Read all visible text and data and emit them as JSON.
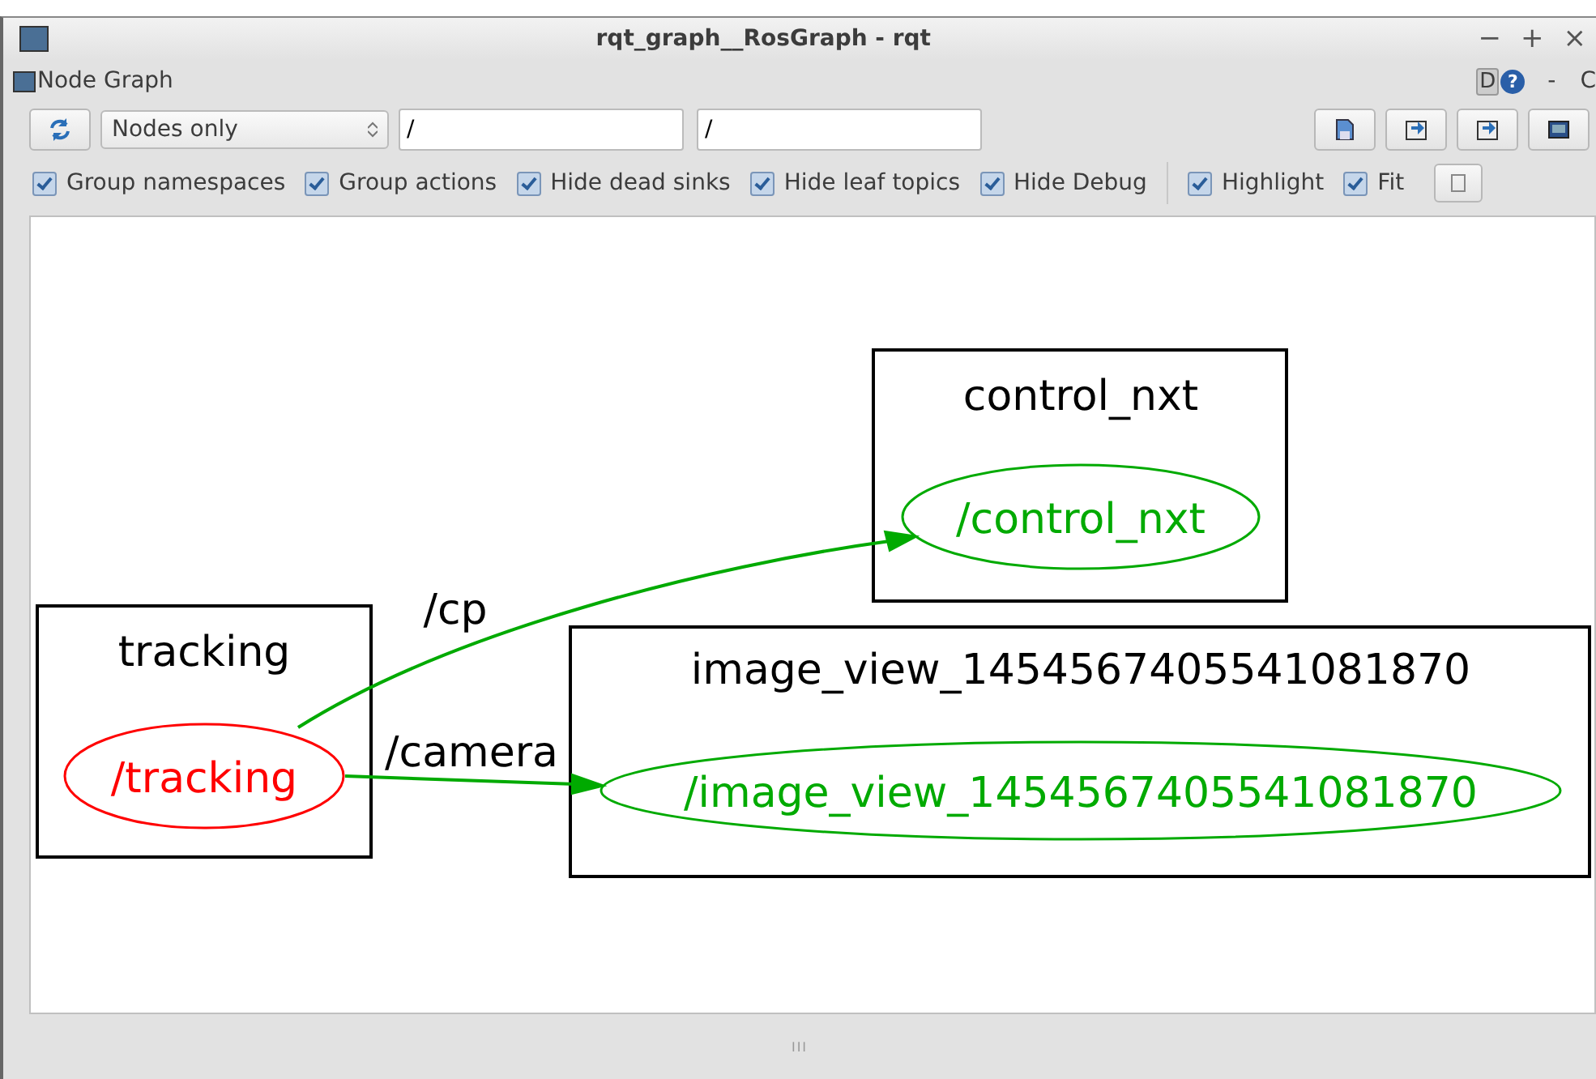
{
  "window": {
    "title": "rqt_graph__RosGraph - rqt",
    "controls": [
      "−",
      "+",
      "×"
    ]
  },
  "plugin": {
    "title": "Node Graph",
    "help_letter": "D",
    "help_glyph": "?",
    "right_marks": [
      "-",
      "C"
    ]
  },
  "toolbar": {
    "mode": "Nodes only",
    "filters": [
      {
        "value": "/"
      },
      {
        "value": "/"
      }
    ]
  },
  "options": [
    {
      "label": "Group namespaces",
      "checked": true
    },
    {
      "label": "Group actions",
      "checked": true
    },
    {
      "label": "Hide dead sinks",
      "checked": true
    },
    {
      "label": "Hide leaf topics",
      "checked": true
    },
    {
      "label": "Hide Debug",
      "checked": true
    },
    {
      "label": "Highlight",
      "checked": true
    },
    {
      "label": "Fit",
      "checked": true
    }
  ],
  "graph": {
    "clusters": [
      {
        "title": "tracking",
        "node": {
          "label": "/tracking",
          "color": "#ff0000"
        }
      },
      {
        "title": "control_nxt",
        "node": {
          "label": "/control_nxt",
          "color": "#00aa00"
        }
      },
      {
        "title": "image_view_1454567405541081870",
        "node": {
          "label": "/image_view_1454567405541081870",
          "color": "#00aa00"
        }
      }
    ],
    "edges": [
      {
        "label": "/cp",
        "color": "#00aa00"
      },
      {
        "label": "/camera",
        "color": "#00aa00"
      }
    ]
  },
  "splitter": {
    "mark": "III"
  }
}
